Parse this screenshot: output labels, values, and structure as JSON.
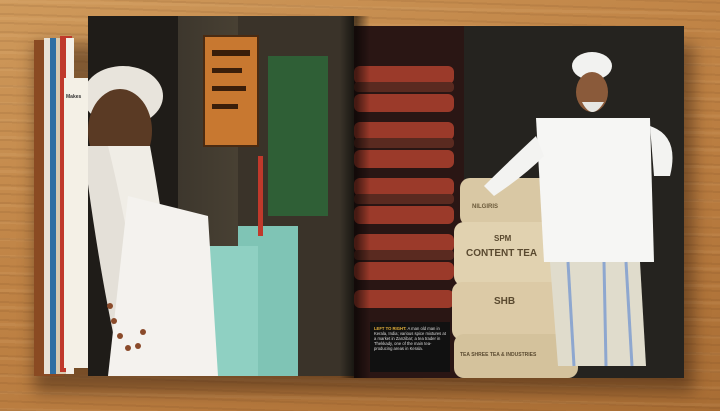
{
  "caption": {
    "lead": "Left to right:",
    "body": "A man old man in Kerala, India; various spice mixtures at a market in Zanzibar; a tea trader in Thekkady, one of the main tea-producing areas in Kerala."
  },
  "underpage_heading": "Makes",
  "sack_texts": [
    "NILGIRIS",
    "SPM",
    "CONTENT TEA",
    "SHB",
    "TEA SHREE TEA & INDUSTRIES"
  ]
}
